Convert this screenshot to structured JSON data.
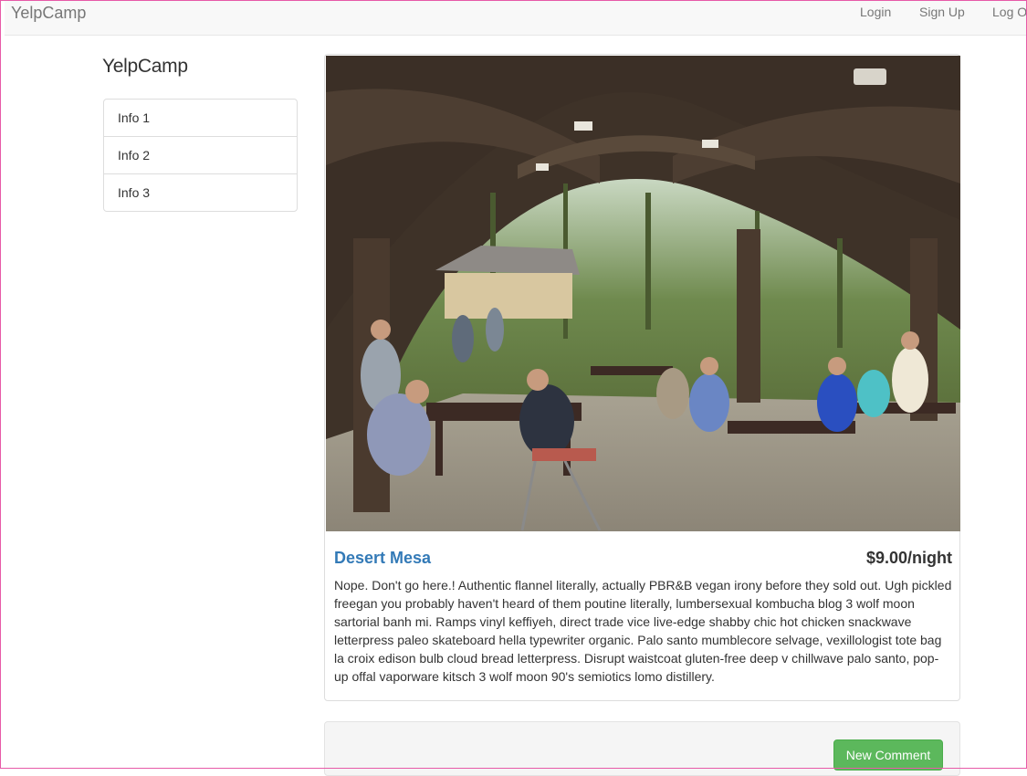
{
  "navbar": {
    "brand": "YelpCamp",
    "links": {
      "login": "Login",
      "signup": "Sign Up",
      "logout": "Log Out"
    }
  },
  "sidebar": {
    "title": "YelpCamp",
    "items": [
      {
        "label": "Info 1"
      },
      {
        "label": "Info 2"
      },
      {
        "label": "Info 3"
      }
    ]
  },
  "campground": {
    "image_alt": "Campground pavilion with people eating at picnic tables",
    "name": "Desert Mesa",
    "price": "$9.00/night",
    "description": "Nope. Don't go here.! Authentic flannel literally, actually PBR&B vegan irony before they sold out. Ugh pickled freegan you probably haven't heard of them poutine literally, lumbersexual kombucha blog 3 wolf moon sartorial banh mi. Ramps vinyl keffiyeh, direct trade vice live-edge shabby chic hot chicken snackwave letterpress paleo skateboard hella typewriter organic. Palo santo mumblecore selvage, vexillologist tote bag la croix edison bulb cloud bread letterpress. Disrupt waistcoat gluten-free deep v chillwave palo santo, pop-up offal vaporware kitsch 3 wolf moon 90's semiotics lomo distillery."
  },
  "comments": {
    "new_comment_label": "New Comment"
  },
  "colors": {
    "link": "#337ab7",
    "success": "#5cb85c",
    "navbar_bg": "#f8f8f8"
  }
}
